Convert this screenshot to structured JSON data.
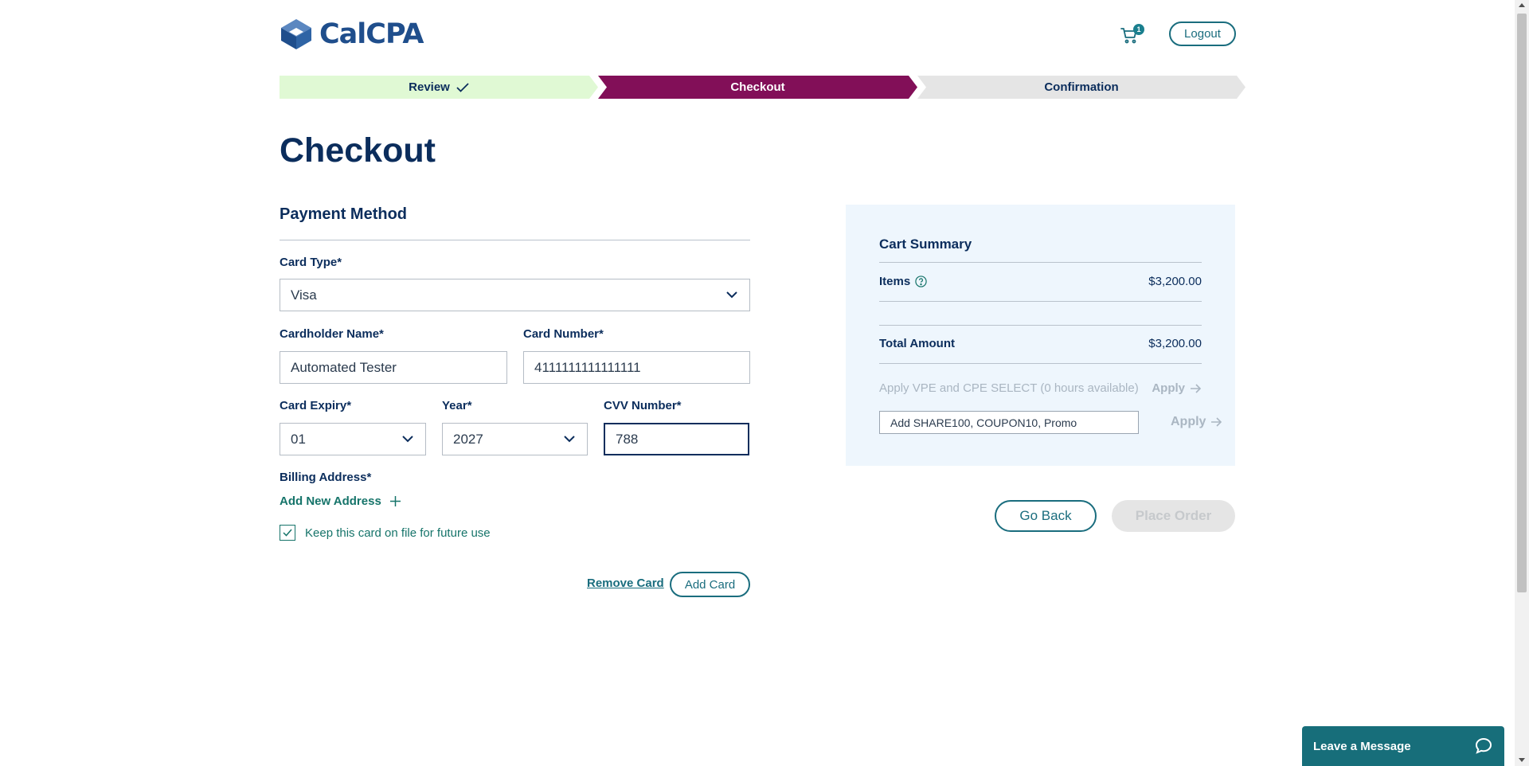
{
  "header": {
    "logo_text": "CalCPA",
    "cart_count": "1",
    "logout_label": "Logout"
  },
  "steps": [
    {
      "label": "Review",
      "state": "complete"
    },
    {
      "label": "Checkout",
      "state": "active"
    },
    {
      "label": "Confirmation",
      "state": "upcoming"
    }
  ],
  "page_title": "Checkout",
  "payment": {
    "section_title": "Payment Method",
    "card_type_label": "Card Type*",
    "card_type_value": "Visa",
    "cardholder_label": "Cardholder Name*",
    "cardholder_value": "Automated Tester",
    "card_number_label": "Card Number*",
    "card_number_value": "4111111111111111",
    "expiry_label": "Card Expiry*",
    "expiry_value": "01",
    "year_label": "Year*",
    "year_value": "2027",
    "cvv_label": "CVV Number*",
    "cvv_value": "788",
    "billing_label": "Billing Address*",
    "add_address_label": "Add New Address",
    "keep_card_label": "Keep this card on file for future use",
    "keep_card_checked": true,
    "remove_card_label": "Remove Card",
    "add_card_label": "Add Card"
  },
  "summary": {
    "title": "Cart Summary",
    "items_label": "Items",
    "items_value": "$3,200.00",
    "total_label": "Total Amount",
    "total_value": "$3,200.00",
    "vpe_label": "Apply VPE and CPE SELECT (0 hours available)",
    "apply_label": "Apply",
    "promo_placeholder": "Add SHARE100, COUPON10, Promo"
  },
  "actions": {
    "go_back_label": "Go Back",
    "place_order_label": "Place Order"
  },
  "chat": {
    "label": "Leave a Message"
  },
  "colors": {
    "brand_navy": "#0b2d5c",
    "teal": "#1a6d7e",
    "step_active": "#820f58",
    "step_done": "#e0f9d4",
    "summary_bg": "#eef6fd"
  }
}
